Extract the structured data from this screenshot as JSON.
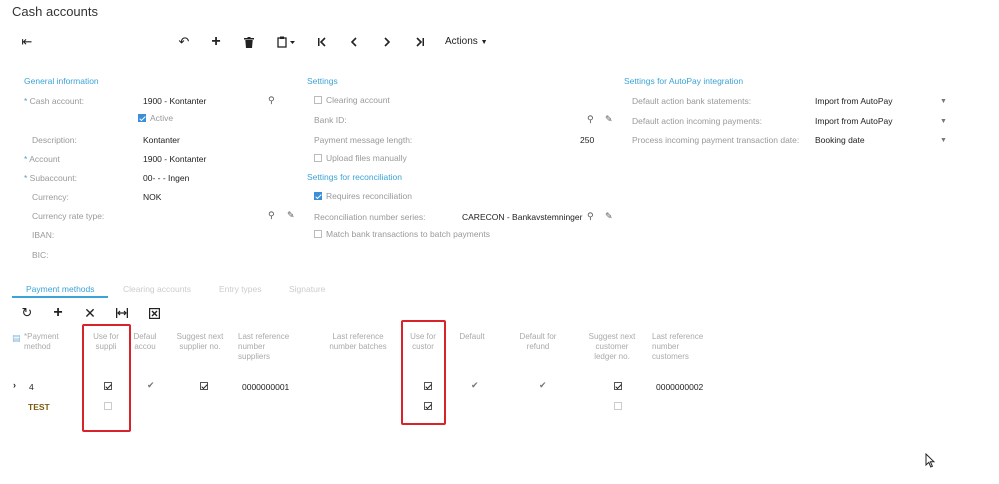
{
  "title": "Cash accounts",
  "toolbar": {
    "actions_label": "Actions"
  },
  "general": {
    "heading": "General information",
    "cash_account_label": "Cash account:",
    "cash_account_value": "1900 - Kontanter",
    "active_label": "Active",
    "description_label": "Description:",
    "description_value": "Kontanter",
    "account_label": "Account",
    "account_value": "1900 - Kontanter",
    "subaccount_label": "Subaccount:",
    "subaccount_value": "00-   - - Ingen",
    "currency_label": "Currency:",
    "currency_value": "NOK",
    "currency_rate_type_label": "Currency rate type:",
    "iban_label": "IBAN:",
    "bic_label": "BIC:"
  },
  "settings": {
    "heading": "Settings",
    "clearing_account_label": "Clearing account",
    "bank_id_label": "Bank ID:",
    "payment_message_length_label": "Payment message length:",
    "payment_message_length_value": "250",
    "upload_files_label": "Upload files manually"
  },
  "reconciliation": {
    "heading": "Settings for reconciliation",
    "requires_label": "Requires reconciliation",
    "number_series_label": "Reconciliation number series:",
    "number_series_value": "CARECON - Bankavstemninger",
    "match_label": "Match bank transactions to batch payments"
  },
  "autopay": {
    "heading": "Settings for AutoPay integration",
    "bank_statements_label": "Default action bank statements:",
    "bank_statements_value": "Import from AutoPay",
    "incoming_payments_label": "Default action incoming payments:",
    "incoming_payments_value": "Import from AutoPay",
    "process_date_label": "Process incoming payment transaction date:",
    "process_date_value": "Booking date"
  },
  "tabs": [
    "Payment methods",
    "Clearing accounts",
    "Entry types",
    "Signature"
  ],
  "grid": {
    "columns": [
      "*Payment method",
      "Use for suppli",
      "Defaul accou",
      "Suggest next supplier no.",
      "Last reference number suppliers",
      "Last reference number batches",
      "Use for custor",
      "Default",
      "Default for refund",
      "Suggest next customer ledger no.",
      "Last reference number customers"
    ],
    "rows": [
      {
        "method": "4",
        "last_ref_suppliers": "0000000001",
        "last_ref_customers": "0000000002"
      },
      {
        "method": "TEST",
        "last_ref_suppliers": "",
        "last_ref_customers": ""
      }
    ]
  },
  "colors": {
    "accent": "#3ba3d6",
    "highlight": "#d9232b",
    "checkbox": "#3b8fd9"
  }
}
